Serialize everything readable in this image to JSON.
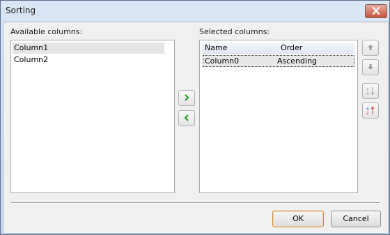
{
  "window": {
    "title": "Sorting"
  },
  "available": {
    "label": "Available columns:",
    "items": [
      {
        "label": "Column1",
        "selected": true
      },
      {
        "label": "Column2",
        "selected": false
      }
    ]
  },
  "selected": {
    "label": "Selected columns:",
    "headers": {
      "name": "Name",
      "order": "Order"
    },
    "rows": [
      {
        "name": "Column0",
        "order": "Ascending"
      }
    ]
  },
  "transfer": {
    "add_icon": "chevron-right-icon",
    "remove_icon": "chevron-left-icon",
    "accent": "#2a9a2a"
  },
  "side_buttons": {
    "move_up_icon": "arrow-up-icon",
    "move_down_icon": "arrow-down-icon",
    "sort_descending_icon": "sort-descending-icon",
    "sort_ascending_icon": "sort-ascending-icon"
  },
  "buttons": {
    "ok": "OK",
    "cancel": "Cancel"
  }
}
